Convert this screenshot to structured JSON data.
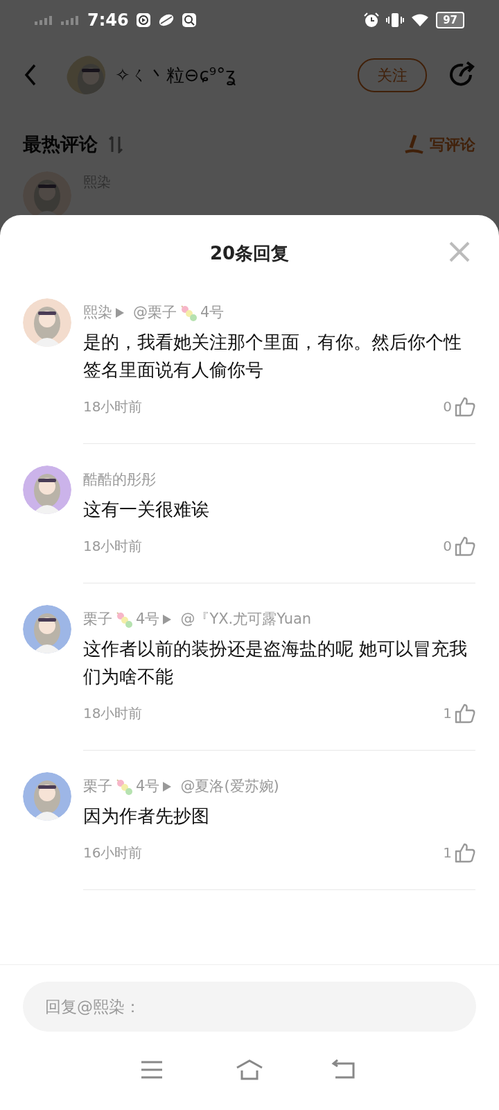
{
  "status_bar": {
    "time": "7:46",
    "battery": "97"
  },
  "header": {
    "user_name": "✧ㄑ丶粒⊖ɕ⁹°ʓ",
    "follow": "关注"
  },
  "hot_comments": {
    "title": "最热评论",
    "write": "写评论",
    "first_author": "熙染"
  },
  "sheet": {
    "title": "20条回复",
    "replies": [
      {
        "name_parts": [
          "熙染"
        ],
        "target_parts": [
          "@栗子",
          "4号"
        ],
        "text": "是的，我看她关注那个里面，有你。然后你个性签名里面说有人偷你号",
        "time": "18小时前",
        "likes": "0"
      },
      {
        "name_parts": [
          "酷酷的彤彤"
        ],
        "text": "这有一关很难诶",
        "time": "18小时前",
        "likes": "0"
      },
      {
        "name_parts": [
          "栗子",
          "4号"
        ],
        "target_parts": [
          "@『YX.尤可露Yuan"
        ],
        "text": "这作者以前的装扮还是盗海盐的呢 她可以冒充我们为啥不能",
        "time": "18小时前",
        "likes": "1"
      },
      {
        "name_parts": [
          "栗子",
          "4号"
        ],
        "target_parts": [
          "@夏洛(爱苏婉)"
        ],
        "text": "因为作者先抄图",
        "time": "16小时前",
        "likes": "1"
      }
    ],
    "reply_field": {
      "placeholder": "回复@熙染："
    }
  }
}
